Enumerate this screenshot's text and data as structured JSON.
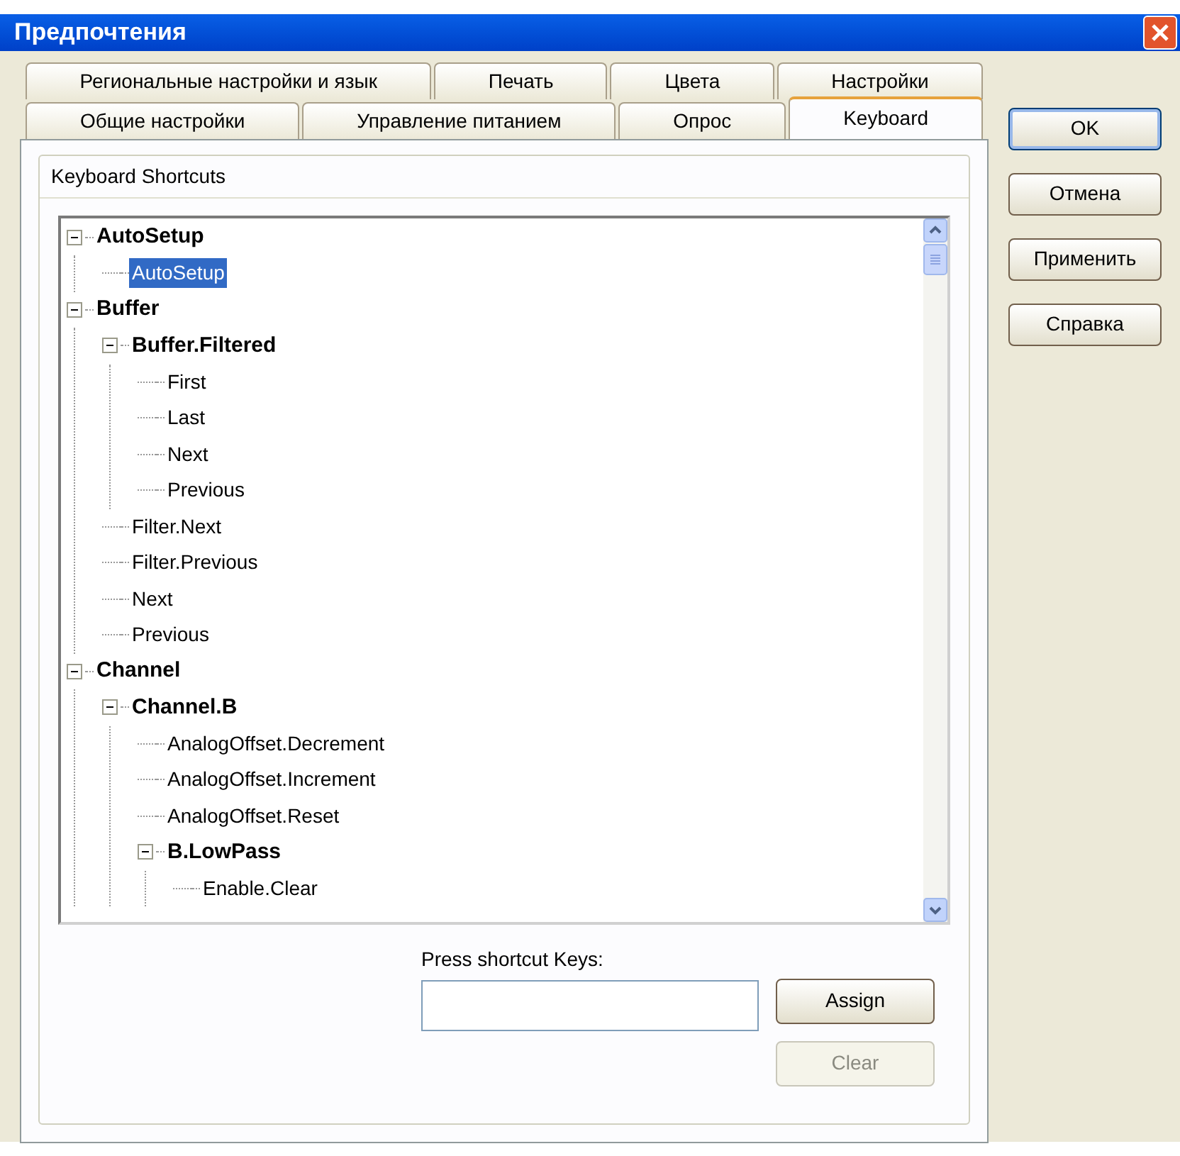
{
  "window": {
    "title": "Предпочтения"
  },
  "tab_rows": [
    [
      {
        "label": "Региональные настройки и язык",
        "selected": false
      },
      {
        "label": "Печать",
        "selected": false
      },
      {
        "label": "Цвета",
        "selected": false
      },
      {
        "label": "Настройки",
        "selected": false
      }
    ],
    [
      {
        "label": "Общие настройки",
        "selected": false
      },
      {
        "label": "Управление питанием",
        "selected": false
      },
      {
        "label": "Опрос",
        "selected": false
      },
      {
        "label": "Keyboard",
        "selected": true
      }
    ]
  ],
  "group": {
    "title": "Keyboard Shortcuts"
  },
  "tree": [
    {
      "label": "AutoSetup",
      "expanded": true,
      "selected": false,
      "children": [
        {
          "label": "AutoSetup",
          "selected": true
        }
      ]
    },
    {
      "label": "Buffer",
      "expanded": true,
      "selected": false,
      "children": [
        {
          "label": "Buffer.Filtered",
          "expanded": true,
          "selected": false,
          "children": [
            {
              "label": "First",
              "selected": false
            },
            {
              "label": "Last",
              "selected": false
            },
            {
              "label": "Next",
              "selected": false
            },
            {
              "label": "Previous",
              "selected": false
            }
          ]
        },
        {
          "label": "Filter.Next",
          "selected": false
        },
        {
          "label": "Filter.Previous",
          "selected": false
        },
        {
          "label": "Next",
          "selected": false
        },
        {
          "label": "Previous",
          "selected": false
        }
      ]
    },
    {
      "label": "Channel",
      "expanded": true,
      "selected": false,
      "children": [
        {
          "label": "Channel.B",
          "expanded": true,
          "selected": false,
          "children": [
            {
              "label": "AnalogOffset.Decrement",
              "selected": false
            },
            {
              "label": "AnalogOffset.Increment",
              "selected": false
            },
            {
              "label": "AnalogOffset.Reset",
              "selected": false
            },
            {
              "label": "B.LowPass",
              "expanded": true,
              "selected": false,
              "children": [
                {
                  "label": "Enable.Clear",
                  "selected": false
                }
              ]
            }
          ]
        }
      ]
    }
  ],
  "shortcut": {
    "label": "Press shortcut Keys:"
  },
  "shortcut_buttons": [
    {
      "label": "Assign",
      "disabled": false
    },
    {
      "label": "Clear",
      "disabled": true
    }
  ],
  "dialog_buttons": [
    {
      "label": "OK",
      "default": true
    },
    {
      "label": "Отмена",
      "default": false
    },
    {
      "label": "Применить",
      "default": false
    },
    {
      "label": "Справка",
      "default": false
    }
  ]
}
